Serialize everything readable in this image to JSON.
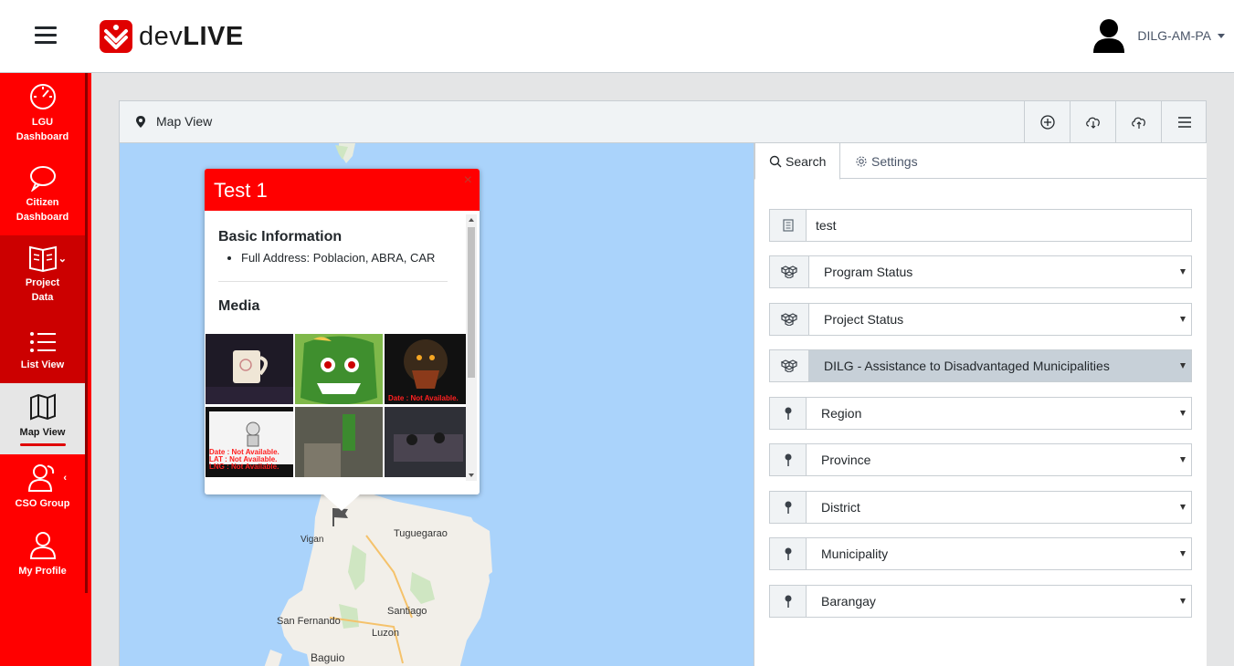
{
  "header": {
    "brand_prefix": "dev",
    "brand_suffix": "LIVE",
    "user_name": "DILG-AM-PA"
  },
  "sidebar": {
    "items": [
      {
        "label_line1": "LGU",
        "label_line2": "Dashboard",
        "icon": "speedometer-icon"
      },
      {
        "label_line1": "Citizen",
        "label_line2": "Dashboard",
        "icon": "speech-bubble-icon"
      },
      {
        "label_line1": "Project",
        "label_line2": "Data",
        "icon": "book-icon"
      },
      {
        "label_line1": "List View",
        "label_line2": "",
        "icon": "list-icon"
      },
      {
        "label_line1": "Map View",
        "label_line2": "",
        "icon": "map-icon"
      },
      {
        "label_line1": "CSO Group",
        "label_line2": "",
        "icon": "users-icon"
      },
      {
        "label_line1": "My Profile",
        "label_line2": "",
        "icon": "user-icon"
      }
    ]
  },
  "card": {
    "title": "Map View",
    "header_buttons": [
      "plus-circle-icon",
      "cloud-download-icon",
      "cloud-upload-icon",
      "menu-icon"
    ]
  },
  "map": {
    "labels": {
      "vigan": "Vigan",
      "tuguegarao": "Tuguegarao",
      "santiago": "Santiago",
      "san_fernando": "San Fernando",
      "luzon": "Luzon",
      "baguio": "Baguio"
    },
    "popup": {
      "title": "Test 1",
      "close": "×",
      "basic_info_heading": "Basic Information",
      "address": "Full Address: Poblacion, ABRA, CAR",
      "media_heading": "Media",
      "na_text": "Date : Not Available.",
      "na_lat": "LAT : Not Available.",
      "na_lng": "LNG : Not Available."
    }
  },
  "panel": {
    "tabs": [
      {
        "label": "Search",
        "active": true
      },
      {
        "label": "Settings",
        "active": false
      }
    ],
    "search_value": "test",
    "selects": [
      {
        "label": "Program Status",
        "icon": "cubes-icon",
        "highlight": false
      },
      {
        "label": "Project Status",
        "icon": "cubes-icon",
        "highlight": false
      },
      {
        "label": "DILG - Assistance to Disadvantaged Municipalities",
        "icon": "cubes-icon",
        "highlight": true
      },
      {
        "label": "Region",
        "icon": "pin-icon",
        "highlight": false
      },
      {
        "label": "Province",
        "icon": "pin-icon",
        "highlight": false
      },
      {
        "label": "District",
        "icon": "pin-icon",
        "highlight": false
      },
      {
        "label": "Municipality",
        "icon": "pin-icon",
        "highlight": false
      },
      {
        "label": "Barangay",
        "icon": "pin-icon",
        "highlight": false
      }
    ]
  },
  "colors": {
    "brand_red": "#ff0000",
    "sidebar_dark": "#cc0000",
    "map_water": "#aad3fb",
    "highlight_select": "#c7d0d8"
  }
}
